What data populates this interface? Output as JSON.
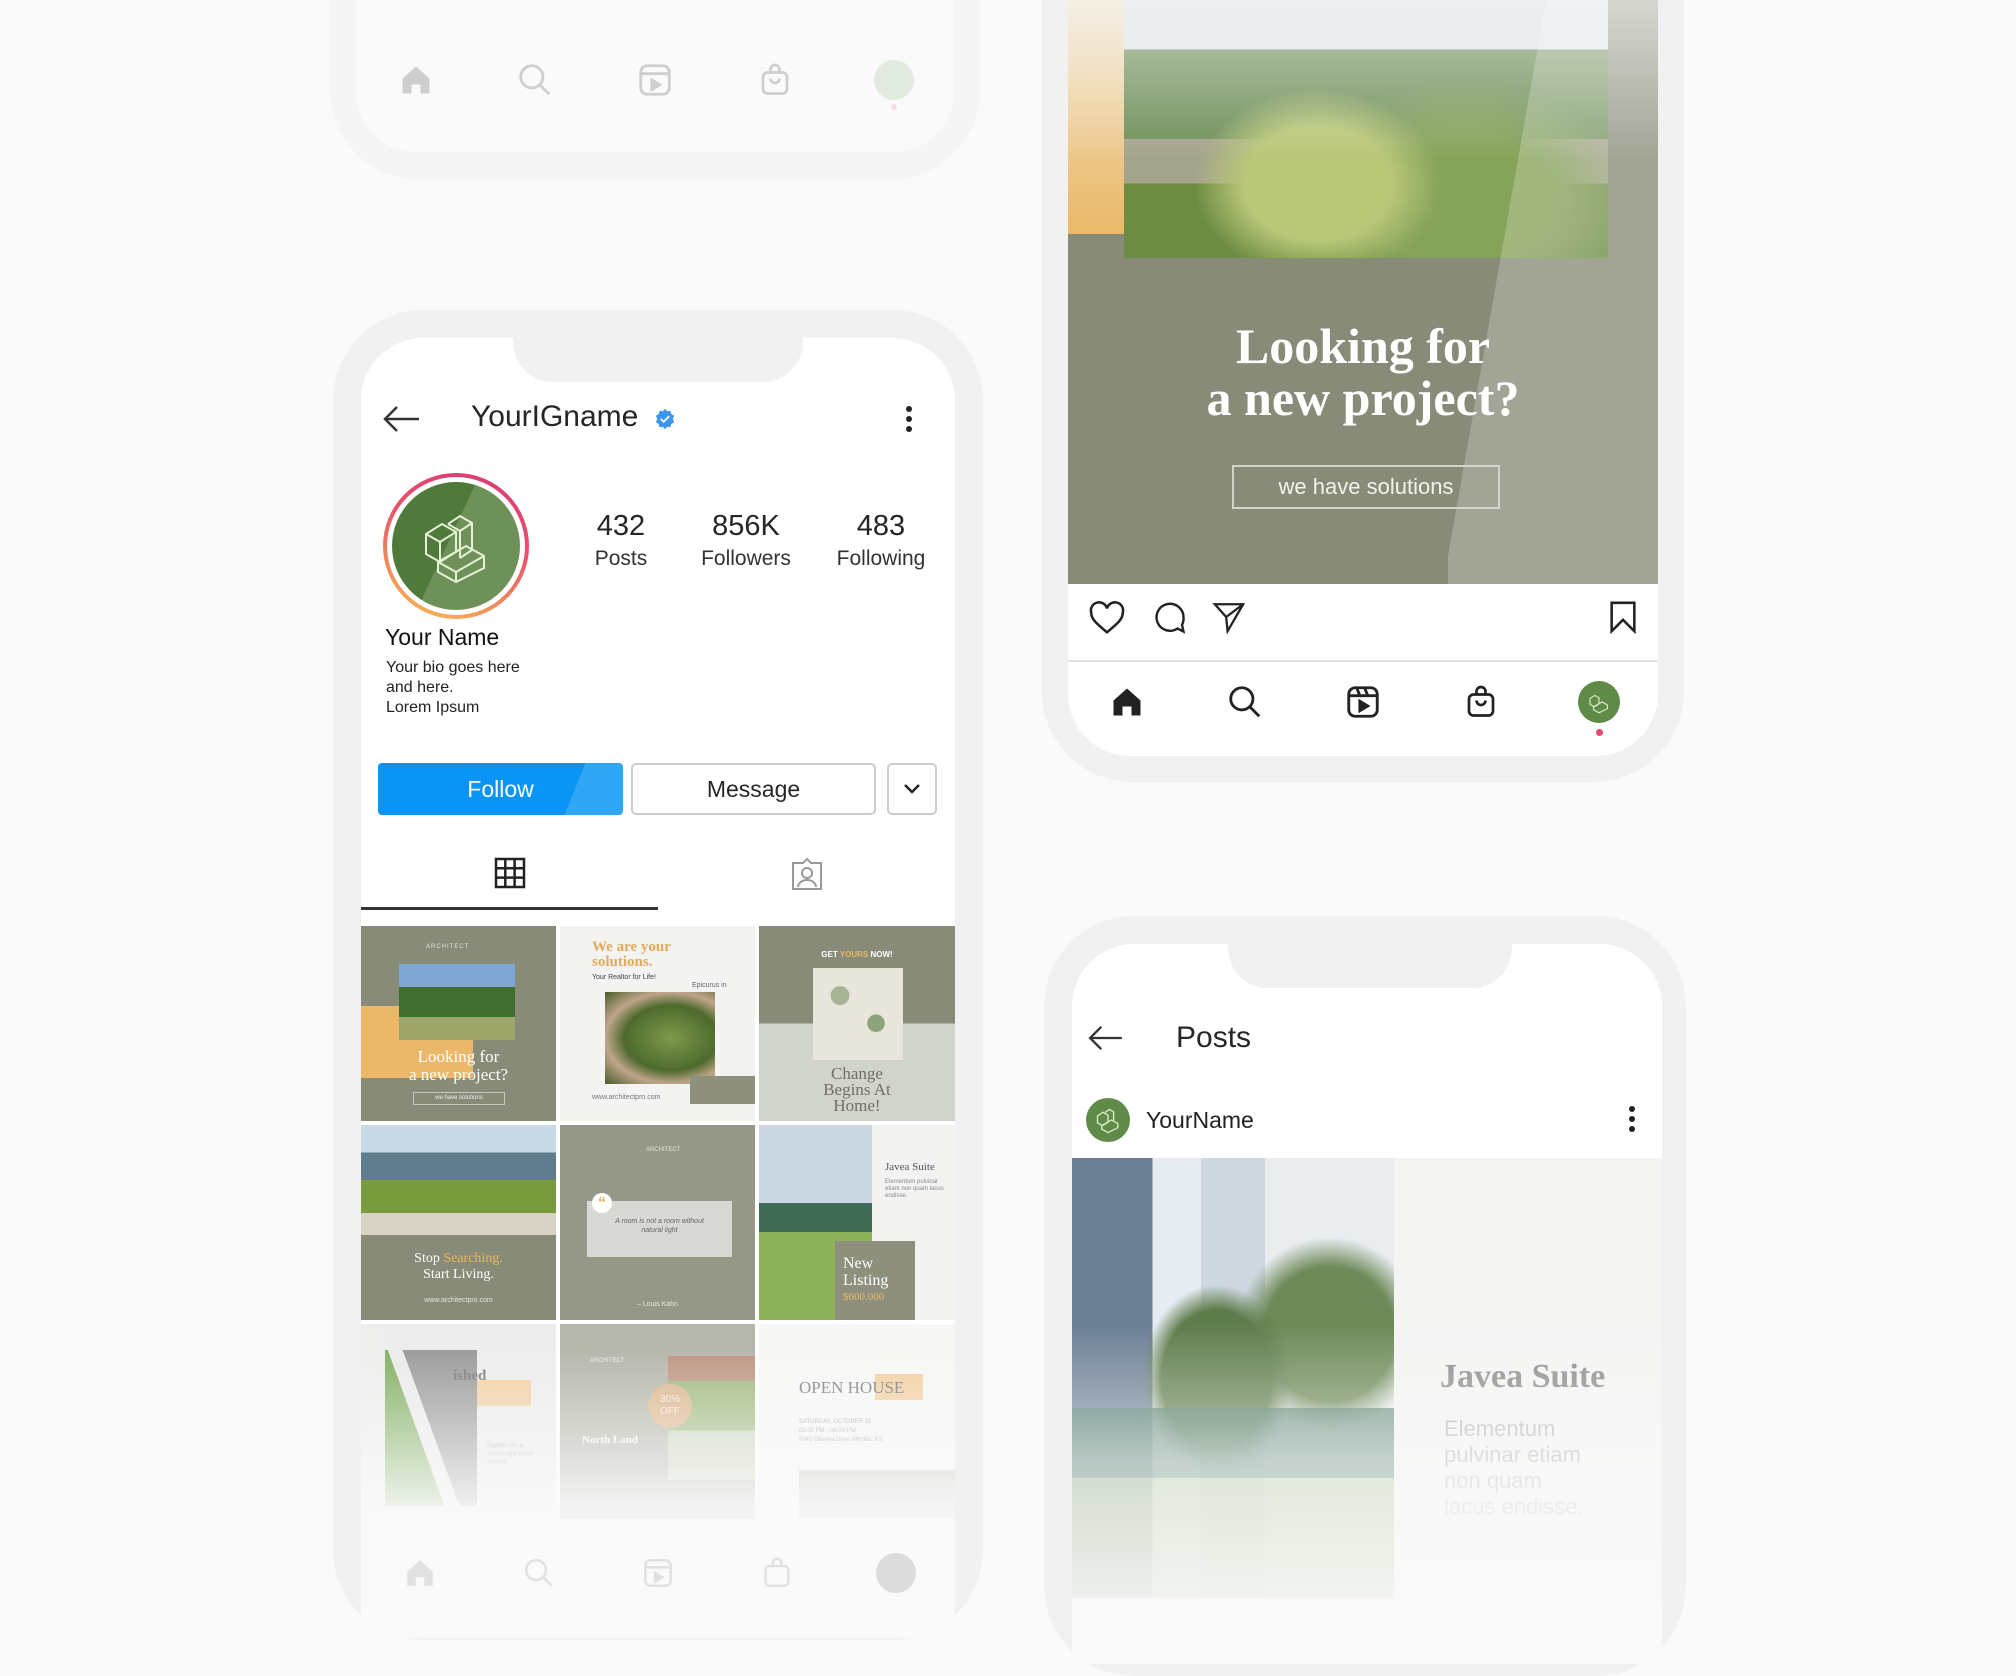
{
  "profile": {
    "username": "YourIGname",
    "verified": true,
    "stats": [
      {
        "value": "432",
        "label": "Posts"
      },
      {
        "value": "856K",
        "label": "Followers"
      },
      {
        "value": "483",
        "label": "Following"
      }
    ],
    "display_name": "Your Name",
    "bio_lines": [
      "Your bio goes here",
      "and here.",
      "Lorem Ipsum"
    ],
    "follow_label": "Follow",
    "message_label": "Message",
    "tabs": [
      {
        "icon": "grid-icon",
        "active": true
      },
      {
        "icon": "tagged-icon",
        "active": false
      }
    ],
    "grid": [
      {
        "type": "looking",
        "title_1": "Looking for",
        "title_2": "a new project?",
        "button": "we have solutions",
        "brand": "ARCHITECT"
      },
      {
        "type": "solutions",
        "title_1": "We are your",
        "title_2": "solutions.",
        "subtitle": "Your Realtor for Life!",
        "side_text": "Epicurus in",
        "url": "www.architectpro.com"
      },
      {
        "type": "change",
        "kicker_1": "GET",
        "kicker_2": "YOURS",
        "kicker_3": "NOW!",
        "title_1": "Change",
        "title_2": "Begins At",
        "title_3": "Home!"
      },
      {
        "type": "stop",
        "title_1": "Stop",
        "title_2": "Searching.",
        "title_3": "Start Living.",
        "url": "www.architectpro.com"
      },
      {
        "type": "quote",
        "brand": "ARCHITECT",
        "quote_1": "A room is not a room without",
        "quote_2": "natural light",
        "author": "– Louis Kahn"
      },
      {
        "type": "listing",
        "title": "Javea Suite",
        "body": "Elementum pulvinar etiam non quam lacus endisse.",
        "label_1": "New",
        "label_2": "Listing",
        "price": "$600.000"
      },
      {
        "type": "finished",
        "title": "ished",
        "body": "Sagittis orci a scelerisque purus semper"
      },
      {
        "type": "northland",
        "brand": "ARCHITECT",
        "badge_1": "30%",
        "badge_2": "OFF",
        "title": "North Land"
      },
      {
        "type": "openhouse",
        "title_1": "OPEN HO",
        "title_2": "USE",
        "date": "SATURDAY, OCTOBER 15",
        "time": "03.00 PM - 06.00 PM",
        "address": "9042 Oliveira Drive Wichita, KS"
      }
    ]
  },
  "post_preview": {
    "title_1": "Looking for",
    "title_2": "a new project?",
    "button": "we have solutions"
  },
  "posts_screen": {
    "title": "Posts",
    "author": "YourName",
    "card_title": "Javea Suite",
    "card_body_lines": [
      "Elementum",
      "pulvinar etiam",
      "non quam",
      "lacus endisse."
    ]
  },
  "nav": [
    "home-icon",
    "search-icon",
    "reels-icon",
    "shop-icon",
    "profile-avatar"
  ],
  "colors": {
    "follow_blue": "#0a95f6",
    "sage": "#888b77",
    "accent_orange": "#eab868",
    "avatar_green": "#5f8a48",
    "notification_dot": "#e8486f"
  }
}
